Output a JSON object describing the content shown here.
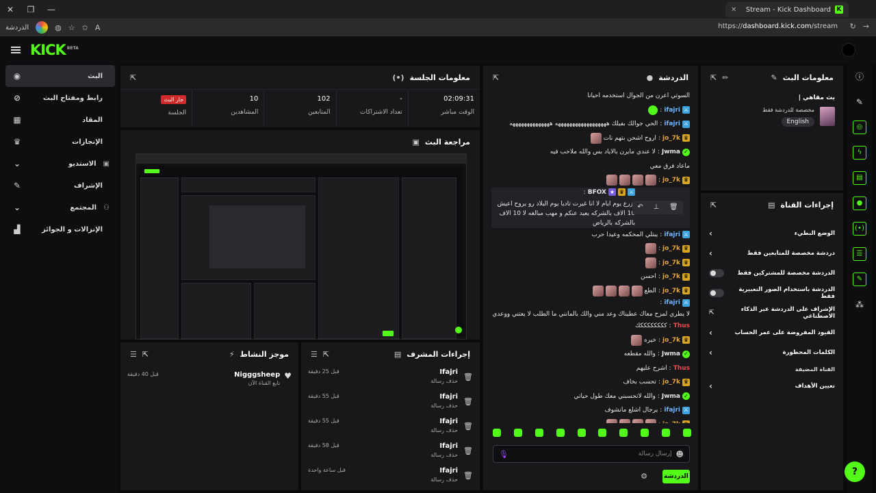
{
  "browser": {
    "tab_title": "Stream - Kick Dashboard",
    "url_prefix": "https://",
    "url_host": "dashboard.kick.com",
    "url_path": "/stream",
    "left_label": "الدردشة"
  },
  "header": {
    "logo": "KICK",
    "logo_badge": "BETA"
  },
  "sidebar": {
    "items": [
      {
        "label": "البث",
        "icon": "broadcast-icon",
        "glyph": "◉"
      },
      {
        "label": "رابط ومفتاح البث",
        "icon": "link-icon",
        "glyph": "⊘"
      },
      {
        "label": "المقاد",
        "icon": "grid-icon",
        "glyph": "▦"
      },
      {
        "label": "الإنجازات",
        "icon": "trophy-icon",
        "glyph": "♛"
      },
      {
        "label": "الاستديو",
        "icon": "chevron-down-icon",
        "glyph": "⌄",
        "extra": "▣"
      },
      {
        "label": "الإشراف",
        "icon": "wrench-icon",
        "glyph": "✎"
      },
      {
        "label": "المجتمع",
        "icon": "chevron-down-icon",
        "glyph": "⌄",
        "extra": "⚇"
      },
      {
        "label": "الإنزالات و الجوائز",
        "icon": "gift-icon",
        "glyph": "▟"
      }
    ]
  },
  "session": {
    "title": "معلومات الجلسة",
    "stats": [
      {
        "value": "02:09:31",
        "label": "الوقت مباشر"
      },
      {
        "value": "-",
        "label": "تعداد الاشتراكات"
      },
      {
        "value": "102",
        "label": "المتابعين"
      },
      {
        "value": "10",
        "label": "المشاهدين"
      },
      {
        "badge": "جار البث",
        "label": "الجلسة"
      }
    ]
  },
  "preview": {
    "title": "مراجعة البث"
  },
  "activity": {
    "title": "موجز النشاط",
    "items": [
      {
        "name": "Nigggsheep",
        "sub": "تابع القناة الآن",
        "time": "قبل 40 دقيقة"
      }
    ]
  },
  "mod_actions": {
    "title": "إجراءات المشرف",
    "items": [
      {
        "name": "Ifajri",
        "sub": "حذف رسالة",
        "time": "قبل 25 دقيقة"
      },
      {
        "name": "Ifajri",
        "sub": "حذف رسالة",
        "time": "قبل 55 دقيقة"
      },
      {
        "name": "Ifajri",
        "sub": "حذف رسالة",
        "time": "قبل 55 دقيقة"
      },
      {
        "name": "Ifajri",
        "sub": "حذف رسالة",
        "time": "قبل 58 دقيقة"
      },
      {
        "name": "Ifajri",
        "sub": "حذف رسالة",
        "time": "قبل ساعة واحدة"
      }
    ]
  },
  "chat": {
    "title": "الدردشة",
    "input_placeholder": "إرسال رسالة",
    "send_label": "الدردشة",
    "messages": [
      {
        "user": "",
        "text": "السوتي اعرن من الجوال استخدمه احيانا",
        "badges": [],
        "color": "#e6e6e6"
      },
      {
        "user": "ifajri",
        "text": "",
        "badges": [
          "mod"
        ],
        "color": "#6fb7ff",
        "emote": "green"
      },
      {
        "user": "ifajri",
        "text": "الحي جوالك بفيلك ههههههههههههههههههه ههههههههههههههه",
        "badges": [
          "mod"
        ],
        "color": "#6fb7ff"
      },
      {
        "user": "jo_7k",
        "text": "اروح اشحن بتهم نات",
        "badges": [
          "crown"
        ],
        "color": "#e5a63a",
        "emote": "face"
      },
      {
        "user": "Jwma",
        "text": "لا عندي مايرن بالاياد بس والله ملاحب فيه",
        "badges": [
          "ver"
        ],
        "color": "#e6e6e6"
      },
      {
        "user": "",
        "text": "ماعاد فرق معي",
        "badges": [],
        "color": "#e6e6e6"
      },
      {
        "user": "jo_7k",
        "text": "",
        "badges": [
          "crown"
        ],
        "color": "#e5a63a",
        "emote": "face4"
      },
      {
        "user": "BFOX",
        "text": "يزرع يوم ايام لا انا غيرت تاديا يوم البلاد رو يروح اعيش 10 الاف بالشركه يعيد عنكم و مهب مبالغه لا 10 الاف بالشركه بالرياض",
        "badges": [
          "mod",
          "crown",
          "sub"
        ],
        "color": "#e6e6e6",
        "hover": true
      },
      {
        "user": "ifajri",
        "text": "يبتلي المحكمه وعيدا حرب",
        "badges": [
          "mod"
        ],
        "color": "#6fb7ff"
      },
      {
        "user": "jo_7k",
        "text": "",
        "badges": [
          "crown"
        ],
        "color": "#e5a63a",
        "emote": "face"
      },
      {
        "user": "jo_7k",
        "text": "",
        "badges": [
          "crown"
        ],
        "color": "#e5a63a",
        "emote": "face"
      },
      {
        "user": "jo_7k",
        "text": "احسن",
        "badges": [
          "crown"
        ],
        "color": "#e5a63a"
      },
      {
        "user": "jo_7k",
        "text": "الطع",
        "badges": [
          "crown"
        ],
        "color": "#e5a63a",
        "emote": "face4"
      },
      {
        "user": "ifajri",
        "text": "لا يطري لمزح معاك عطيناك وعد مني والك بالمانني ما الطلب لا يعتني ووعدي",
        "badges": [
          "mod"
        ],
        "color": "#6fb7ff"
      },
      {
        "user": "Thus",
        "text": "ككككككككك",
        "badges": [],
        "color": "#e84b4b"
      },
      {
        "user": "jo_7k",
        "text": "خيره",
        "badges": [
          "crown"
        ],
        "color": "#e5a63a",
        "emote": "face"
      },
      {
        "user": "Jwma",
        "text": "والله مقطعه",
        "badges": [
          "ver"
        ],
        "color": "#e6e6e6"
      },
      {
        "user": "Thus",
        "text": "اشرح عليهم",
        "badges": [],
        "color": "#e84b4b"
      },
      {
        "user": "jo_7k",
        "text": "تحسب بخاف",
        "badges": [
          "crown"
        ],
        "color": "#e5a63a"
      },
      {
        "user": "Jwma",
        "text": "والله لاتحسبني معك طول حياتي",
        "badges": [
          "ver"
        ],
        "color": "#e6e6e6"
      },
      {
        "user": "ifajri",
        "text": "يرجال اشلع مانشوف",
        "badges": [
          "mod"
        ],
        "color": "#6fb7ff"
      },
      {
        "user": "jo_7k",
        "text": "",
        "badges": [
          "crown"
        ],
        "color": "#e5a63a",
        "emote": "face4"
      }
    ]
  },
  "stream_info": {
    "title": "معلومات البث",
    "stream_title": "بث مقاهي |",
    "category": "مخصصة للدردشة فقط",
    "tag": "English"
  },
  "channel_actions": {
    "title": "إجراءات القناة",
    "items": [
      {
        "label": "الوضع البطيء",
        "control": "chevron"
      },
      {
        "label": "دردشة مخصصة للمتابعين فقط",
        "control": "chevron"
      },
      {
        "label": "الدردشة مخصصة للمشتركين فقط",
        "control": "toggle"
      },
      {
        "label": "الدردشة باستخدام الصور التعبيرية فقط",
        "control": "toggle"
      },
      {
        "label": "الإشراف على الدردشة عبر الذكاء الاصطناعي",
        "control": "external"
      },
      {
        "label": "القيود المفروضة على عمر الحساب",
        "control": "chevron"
      },
      {
        "label": "الكلمات المحظورة",
        "control": "chevron"
      }
    ],
    "section_label": "القناة المضيفة",
    "host_item": "تعيين الأهداف"
  },
  "colors": {
    "accent": "#53fc18",
    "live": "#d02a2a",
    "panel": "#18181b"
  }
}
